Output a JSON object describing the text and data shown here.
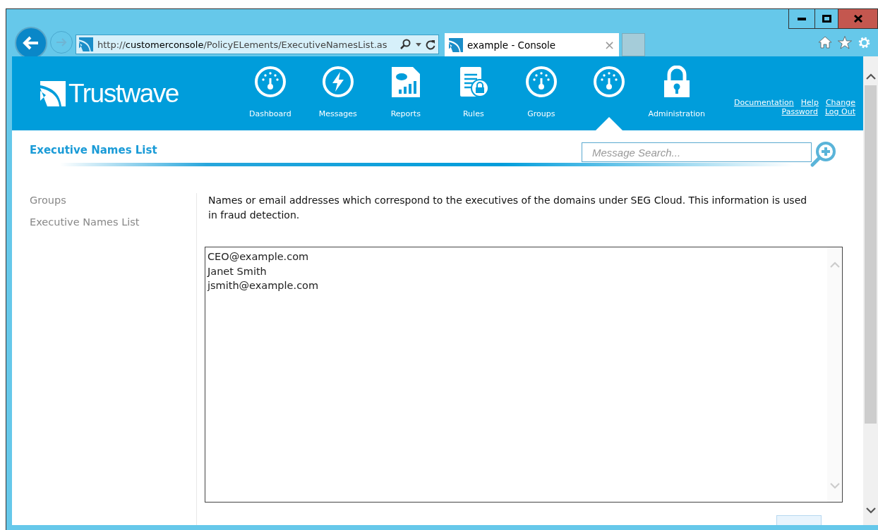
{
  "browser": {
    "url": "http://**customerconsole**/PolicyELements/ExecutiveNamesList.as",
    "tab": {
      "title": "example - Console",
      "close": "×"
    }
  },
  "header": {
    "logo": "Trustwave",
    "nav": [
      {
        "label": "Dashboard",
        "selected": false
      },
      {
        "label": "Messages",
        "selected": false
      },
      {
        "label": "Reports",
        "selected": false
      },
      {
        "label": "Rules",
        "selected": false
      },
      {
        "label": "Groups",
        "selected": false
      },
      {
        "selected": true
      },
      {
        "label": "Administration",
        "selected": false
      }
    ],
    "links": [
      [
        "Documentation",
        "Help",
        "Change"
      ],
      [
        "Password",
        "Log Out"
      ]
    ]
  },
  "page_title": "Executive Names List",
  "search": {
    "placeholder": "Message Search..."
  },
  "sidebar": {
    "items": [
      "Groups",
      "Executive Names List"
    ]
  },
  "description": "Names or email addresses which correspond to the executives of the domains under SEG Cloud. This information is used in fraud detection.",
  "names_field": {
    "value": "CEO@example.com\nJanet Smith\njsmith@example.com\n"
  }
}
